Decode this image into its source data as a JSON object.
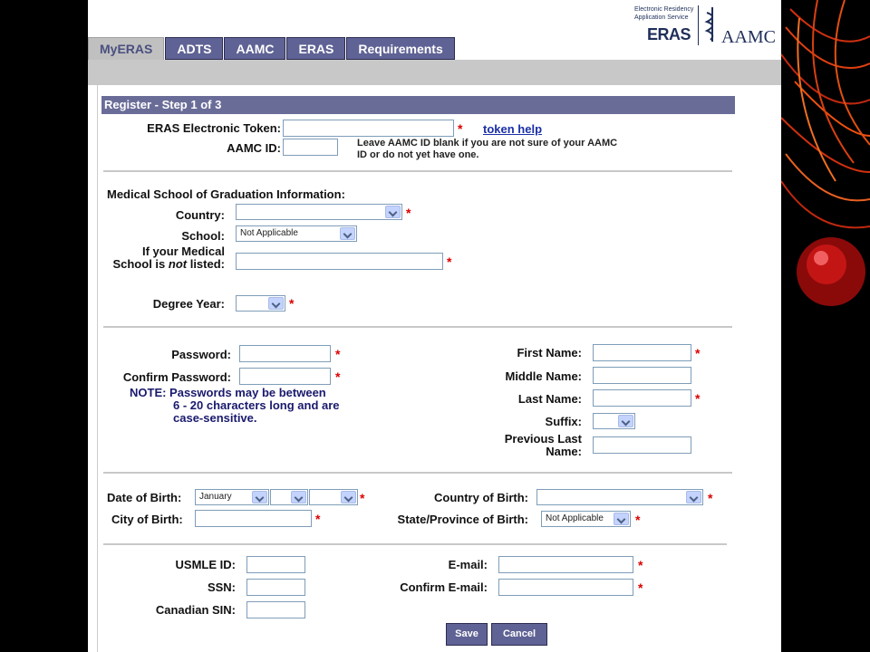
{
  "logo": {
    "line1": "Electronic Residency",
    "line2": "Application Service",
    "eras": "ERAS",
    "aamc": "AAMC"
  },
  "tabs": [
    {
      "label": "MyERAS"
    },
    {
      "label": "ADTS"
    },
    {
      "label": "AAMC"
    },
    {
      "label": "ERAS"
    },
    {
      "label": "Requirements"
    }
  ],
  "form": {
    "header": "Register - Step 1 of 3",
    "token_label": "ERAS Electronic Token:",
    "token_help": "token help",
    "aamc_id_label": "AAMC ID:",
    "aamc_note": "Leave AAMC ID blank if you are not sure of your AAMC ID or do not yet have one.",
    "med_school_heading": "Medical School of Graduation Information:",
    "country_label": "Country:",
    "school_label": "School:",
    "school_value": "Not Applicable",
    "not_listed_label_1": "If your Medical",
    "not_listed_label_2a": "School is ",
    "not_listed_label_2b": "not",
    "not_listed_label_2c": " listed:",
    "degree_year_label": "Degree Year:",
    "password_label": "Password:",
    "confirm_password_label": "Confirm Password:",
    "password_note_1": "NOTE: Passwords may be between",
    "password_note_2": "6 - 20 characters long and are",
    "password_note_3": "case-sensitive.",
    "first_name_label": "First Name:",
    "middle_name_label": "Middle Name:",
    "last_name_label": "Last Name:",
    "suffix_label": "Suffix:",
    "prev_last_name_label_1": "Previous Last",
    "prev_last_name_label_2": "Name:",
    "dob_label": "Date of Birth:",
    "dob_month": "January",
    "country_birth_label": "Country of Birth:",
    "city_birth_label": "City of Birth:",
    "state_birth_label": "State/Province of Birth:",
    "state_birth_value": "Not Applicable",
    "usmle_label": "USMLE ID:",
    "ssn_label": "SSN:",
    "sin_label": "Canadian SIN:",
    "email_label": "E-mail:",
    "confirm_email_label": "Confirm E-mail:",
    "required_mark": "*",
    "save": "Save",
    "cancel": "Cancel"
  },
  "colors": {
    "tab_bg": "#5f6294",
    "header_bg": "#6a6c98",
    "required": "#dd0000",
    "link": "#1b2fa6"
  }
}
